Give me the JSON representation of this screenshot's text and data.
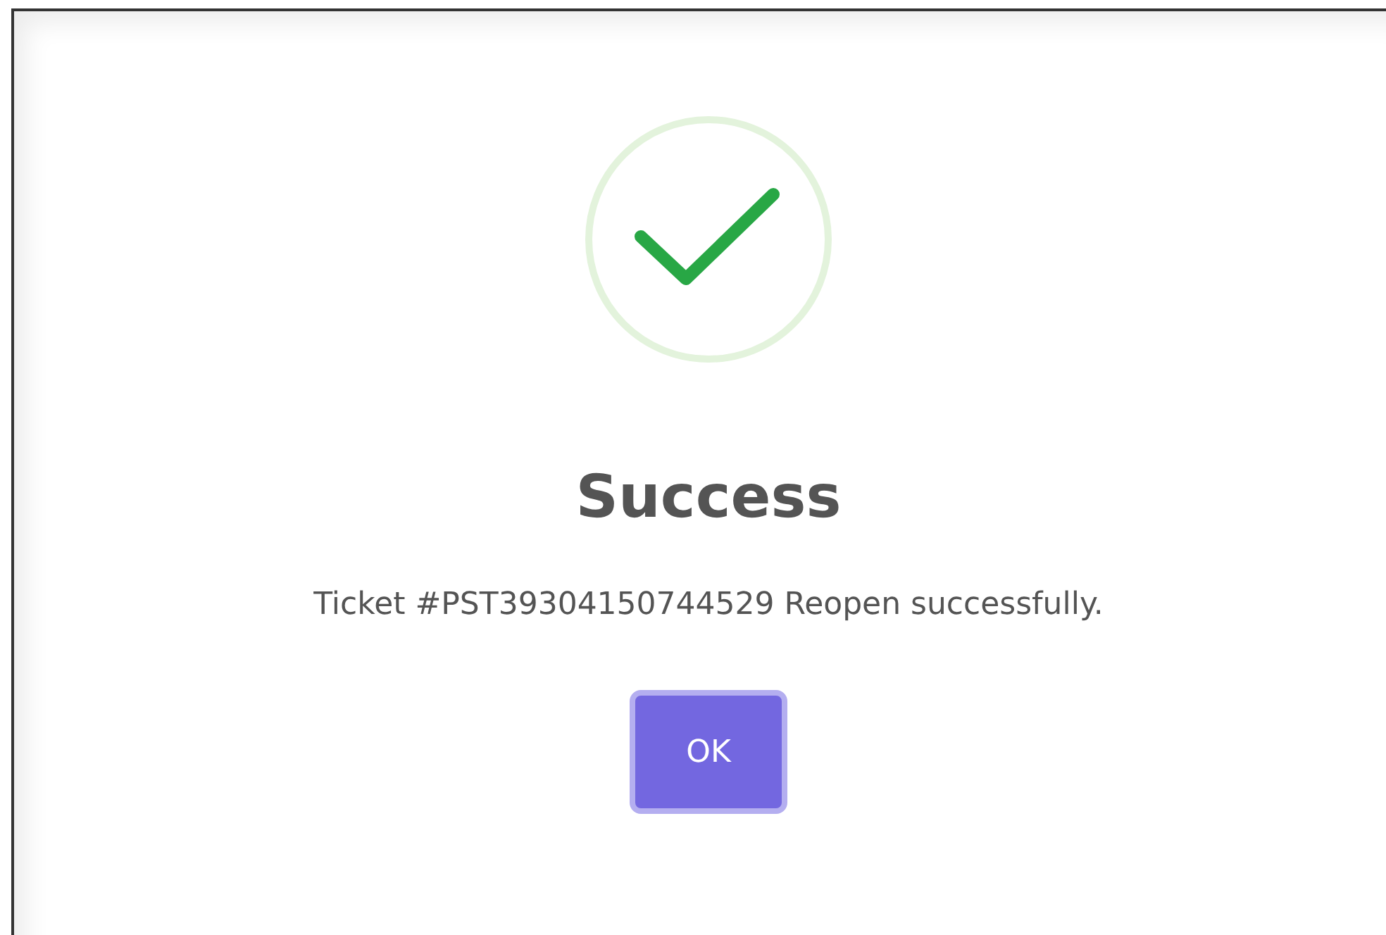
{
  "dialog": {
    "icon": {
      "kind": "success"
    },
    "title": "Success",
    "message": "Ticket #PST39304150744529 Reopen successfully.",
    "buttons": [
      {
        "label": "OK",
        "focused": true
      }
    ]
  }
}
